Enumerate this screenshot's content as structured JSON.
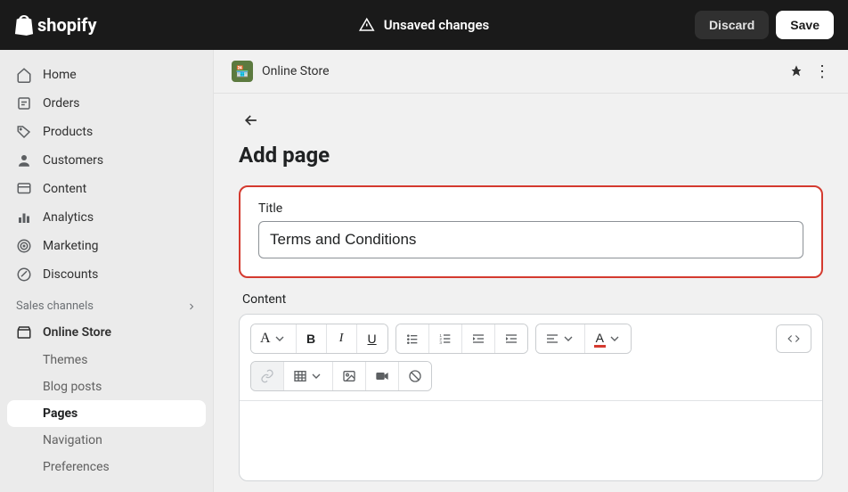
{
  "topbar": {
    "brand": "shopify",
    "unsaved_label": "Unsaved changes",
    "discard_label": "Discard",
    "save_label": "Save"
  },
  "sidebar": {
    "items": [
      {
        "label": "Home"
      },
      {
        "label": "Orders"
      },
      {
        "label": "Products"
      },
      {
        "label": "Customers"
      },
      {
        "label": "Content"
      },
      {
        "label": "Analytics"
      },
      {
        "label": "Marketing"
      },
      {
        "label": "Discounts"
      }
    ],
    "channels_header": "Sales channels",
    "channel": {
      "label": "Online Store"
    },
    "subitems": [
      {
        "label": "Themes",
        "active": false
      },
      {
        "label": "Blog posts",
        "active": false
      },
      {
        "label": "Pages",
        "active": true
      },
      {
        "label": "Navigation",
        "active": false
      },
      {
        "label": "Preferences",
        "active": false
      }
    ]
  },
  "breadcrumb": {
    "app_name": "Online Store"
  },
  "page": {
    "heading": "Add page",
    "title_label": "Title",
    "title_value": "Terms and Conditions",
    "content_label": "Content"
  },
  "toolbar": {
    "format_letter": "A",
    "color_letter": "A"
  }
}
